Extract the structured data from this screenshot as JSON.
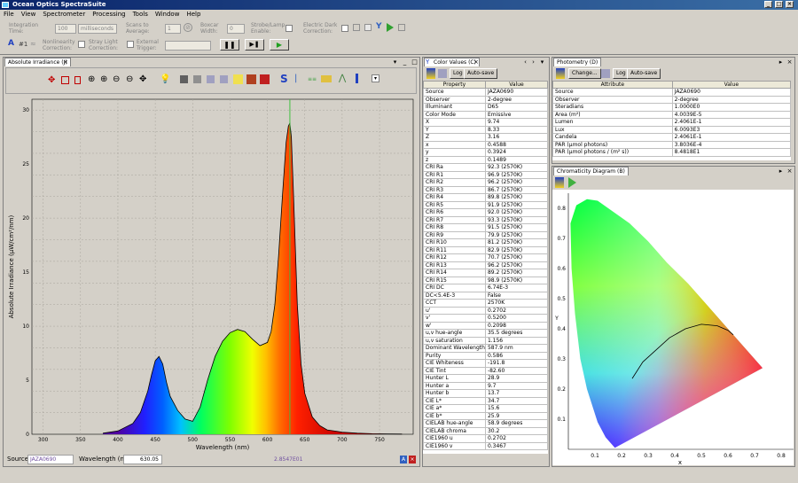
{
  "app": {
    "title": "Ocean Optics SpectraSuite"
  },
  "menu": [
    "File",
    "View",
    "Spectrometer",
    "Processing",
    "Tools",
    "Window",
    "Help"
  ],
  "toolbar": {
    "integration_time_label": "Integration\nTime:",
    "integration_time_value": "100",
    "integration_unit": "milliseconds",
    "scans_label": "Scans to\nAverage:",
    "scans_value": "1",
    "boxcar_label": "Boxcar\nWidth:",
    "boxcar_value": "0",
    "strobe_label": "Strobe/Lamp\nEnable:",
    "dark_label": "Electric Dark\nCorrection:",
    "nonlin_label": "Nonlinearity\nCorrection:",
    "stray_label": "Stray Light\nCorrection:",
    "ext_trigger_label": "External\nTrigger:",
    "hash_label": "#1",
    "pause_icon": "pause-icon",
    "step_icon": "step-icon",
    "play_icon": "play-icon"
  },
  "spectrum_panel": {
    "tab": "Absolute Irradiance (J)",
    "source_label": "Source:",
    "source_value": "JAZA0690",
    "wavelength_label": "Wavelength (nm):",
    "wavelength_value": "630.05",
    "cursor_readout": "2.8547E01"
  },
  "chart_data": {
    "type": "line",
    "xlabel": "Wavelength (nm)",
    "ylabel": "Absolute Irradiance (µW/cm²/nm)",
    "xlim": [
      285,
      795
    ],
    "ylim": [
      0,
      31
    ],
    "xticks": [
      300,
      350,
      400,
      450,
      500,
      550,
      600,
      650,
      700,
      750
    ],
    "grid": true,
    "cursor_x": 630.05,
    "series": [
      {
        "x": [
          380,
          400,
          420,
          430,
          440,
          445,
          450,
          455,
          460,
          465,
          470,
          480,
          490,
          500,
          510,
          520,
          530,
          540,
          550,
          560,
          570,
          580,
          590,
          600,
          605,
          610,
          615,
          620,
          625,
          628,
          630,
          632,
          635,
          640,
          645,
          650,
          660,
          670,
          680,
          700,
          720,
          740,
          760,
          780
        ],
        "values": [
          0.1,
          0.3,
          1.0,
          2.0,
          4.0,
          5.5,
          6.8,
          7.2,
          6.5,
          4.8,
          3.5,
          2.2,
          1.4,
          1.2,
          2.5,
          5.0,
          7.2,
          8.6,
          9.4,
          9.7,
          9.5,
          8.8,
          8.2,
          8.5,
          9.5,
          12.0,
          16.5,
          22.0,
          27.0,
          28.5,
          28.8,
          27.5,
          22.0,
          12.0,
          6.5,
          3.8,
          1.6,
          0.8,
          0.4,
          0.2,
          0.1,
          0.05,
          0.03,
          0.02
        ]
      }
    ]
  },
  "color_panel": {
    "tab": "Color Values (C)",
    "log_label": "Log",
    "autosave_label": "Auto-save",
    "headers": [
      "Property",
      "Value"
    ],
    "rows": [
      [
        "Source",
        "JAZA0690"
      ],
      [
        "Observer",
        "2-degree"
      ],
      [
        "Illuminant",
        "D65"
      ],
      [
        "Color Mode",
        "Emissive"
      ],
      [
        "X",
        "9.74"
      ],
      [
        "Y",
        "8.33"
      ],
      [
        "Z",
        "3.16"
      ],
      [
        "x",
        "0.4588"
      ],
      [
        "y",
        "0.3924"
      ],
      [
        "z",
        "0.1489"
      ],
      [
        "CRI Ra",
        "92.3 (2570K)"
      ],
      [
        "CRI R1",
        "96.9 (2570K)"
      ],
      [
        "CRI R2",
        "96.2 (2570K)"
      ],
      [
        "CRI R3",
        "86.7 (2570K)"
      ],
      [
        "CRI R4",
        "89.8 (2570K)"
      ],
      [
        "CRI R5",
        "91.9 (2570K)"
      ],
      [
        "CRI R6",
        "92.0 (2570K)"
      ],
      [
        "CRI R7",
        "93.3 (2570K)"
      ],
      [
        "CRI R8",
        "91.5 (2570K)"
      ],
      [
        "CRI R9",
        "79.9 (2570K)"
      ],
      [
        "CRI R10",
        "81.2 (2570K)"
      ],
      [
        "CRI R11",
        "82.9 (2570K)"
      ],
      [
        "CRI R12",
        "70.7 (2570K)"
      ],
      [
        "CRI R13",
        "96.2 (2570K)"
      ],
      [
        "CRI R14",
        "89.2 (2570K)"
      ],
      [
        "CRI R15",
        "98.9 (2570K)"
      ],
      [
        "CRI DC",
        "6.74E-3"
      ],
      [
        "DC<5.4E-3",
        "False"
      ],
      [
        "CCT",
        "2570K"
      ],
      [
        "u'",
        "0.2702"
      ],
      [
        "v'",
        "0.5200"
      ],
      [
        "w'",
        "0.2098"
      ],
      [
        "u,v hue-angle",
        "35.5 degrees"
      ],
      [
        "u,v saturation",
        "1.156"
      ],
      [
        "Dominant Wavelength",
        "587.9 nm"
      ],
      [
        "Purity",
        "0.586"
      ],
      [
        "CIE Whiteness",
        "-191.8"
      ],
      [
        "CIE Tint",
        "-82.60"
      ],
      [
        "Hunter L",
        "28.9"
      ],
      [
        "Hunter a",
        "9.7"
      ],
      [
        "Hunter b",
        "13.7"
      ],
      [
        "CIE L*",
        "34.7"
      ],
      [
        "CIE a*",
        "15.6"
      ],
      [
        "CIE b*",
        "25.9"
      ],
      [
        "CIELAB hue-angle",
        "58.9 degrees"
      ],
      [
        "CIELAB chroma",
        "30.2"
      ],
      [
        "CIE1960 u",
        "0.2702"
      ],
      [
        "CIE1960 v",
        "0.3467"
      ]
    ]
  },
  "photometry_panel": {
    "tab": "Photometry (D)",
    "change_label": "Change...",
    "log_label": "Log",
    "autosave_label": "Auto-save",
    "headers": [
      "Attribute",
      "Value"
    ],
    "rows": [
      [
        "Source",
        "JAZA0690"
      ],
      [
        "Observer",
        "2-degree"
      ],
      [
        "Steradians",
        "1.0000E0"
      ],
      [
        "Area (m²)",
        "4.0039E-5"
      ],
      [
        "Lumen",
        "2.4061E-1"
      ],
      [
        "Lux",
        "6.0093E3"
      ],
      [
        "Candela",
        "2.4061E-1"
      ],
      [
        "PAR (µmol photons)",
        "3.8036E-4"
      ],
      [
        "PAR (µmol photons / (m² s))",
        "8.4818E1"
      ]
    ]
  },
  "chromaticity_panel": {
    "tab": "Chromaticity Diagram (B)",
    "xlabel": "x",
    "ylabel": "Y",
    "xticks": [
      "0.1",
      "0.2",
      "0.3",
      "0.4",
      "0.5",
      "0.6",
      "0.7",
      "0.8"
    ],
    "yticks": [
      "0.1",
      "0.2",
      "0.3",
      "0.4",
      "0.5",
      "0.6",
      "0.7",
      "0.8"
    ]
  }
}
